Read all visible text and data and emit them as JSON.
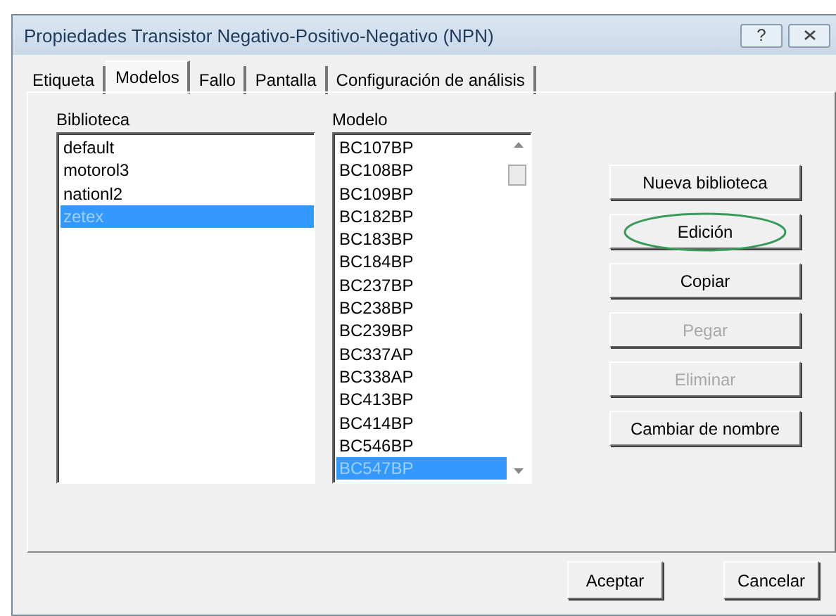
{
  "window": {
    "title": "Propiedades Transistor Negativo-Positivo-Negativo (NPN)",
    "help_button": "?"
  },
  "tabs": [
    {
      "label": "Etiqueta",
      "selected": false
    },
    {
      "label": "Modelos",
      "selected": true
    },
    {
      "label": "Fallo",
      "selected": false
    },
    {
      "label": "Pantalla",
      "selected": false
    },
    {
      "label": "Configuración de análisis",
      "selected": false
    }
  ],
  "library": {
    "label": "Biblioteca",
    "items": [
      {
        "label": "default",
        "selected": false
      },
      {
        "label": "motorol3",
        "selected": false
      },
      {
        "label": "nationl2",
        "selected": false
      },
      {
        "label": "zetex",
        "selected": true
      }
    ]
  },
  "model": {
    "label": "Modelo",
    "items": [
      {
        "label": "BC107BP",
        "selected": false
      },
      {
        "label": "BC108BP",
        "selected": false
      },
      {
        "label": "BC109BP",
        "selected": false
      },
      {
        "label": "BC182BP",
        "selected": false
      },
      {
        "label": "BC183BP",
        "selected": false
      },
      {
        "label": "BC184BP",
        "selected": false
      },
      {
        "label": "BC237BP",
        "selected": false
      },
      {
        "label": "BC238BP",
        "selected": false
      },
      {
        "label": "BC239BP",
        "selected": false
      },
      {
        "label": "BC337AP",
        "selected": false
      },
      {
        "label": "BC338AP",
        "selected": false
      },
      {
        "label": "BC413BP",
        "selected": false
      },
      {
        "label": "BC414BP",
        "selected": false
      },
      {
        "label": "BC546BP",
        "selected": false
      },
      {
        "label": "BC547BP",
        "selected": true
      }
    ]
  },
  "side_buttons": [
    {
      "label": "Nueva biblioteca",
      "disabled": false,
      "circled": false
    },
    {
      "label": "Edición",
      "disabled": false,
      "circled": true
    },
    {
      "label": "Copiar",
      "disabled": false,
      "circled": false
    },
    {
      "label": "Pegar",
      "disabled": true,
      "circled": false
    },
    {
      "label": "Eliminar",
      "disabled": true,
      "circled": false
    },
    {
      "label": "Cambiar de nombre",
      "disabled": false,
      "circled": false
    }
  ],
  "footer_buttons": [
    "Aceptar",
    "Cancelar"
  ]
}
